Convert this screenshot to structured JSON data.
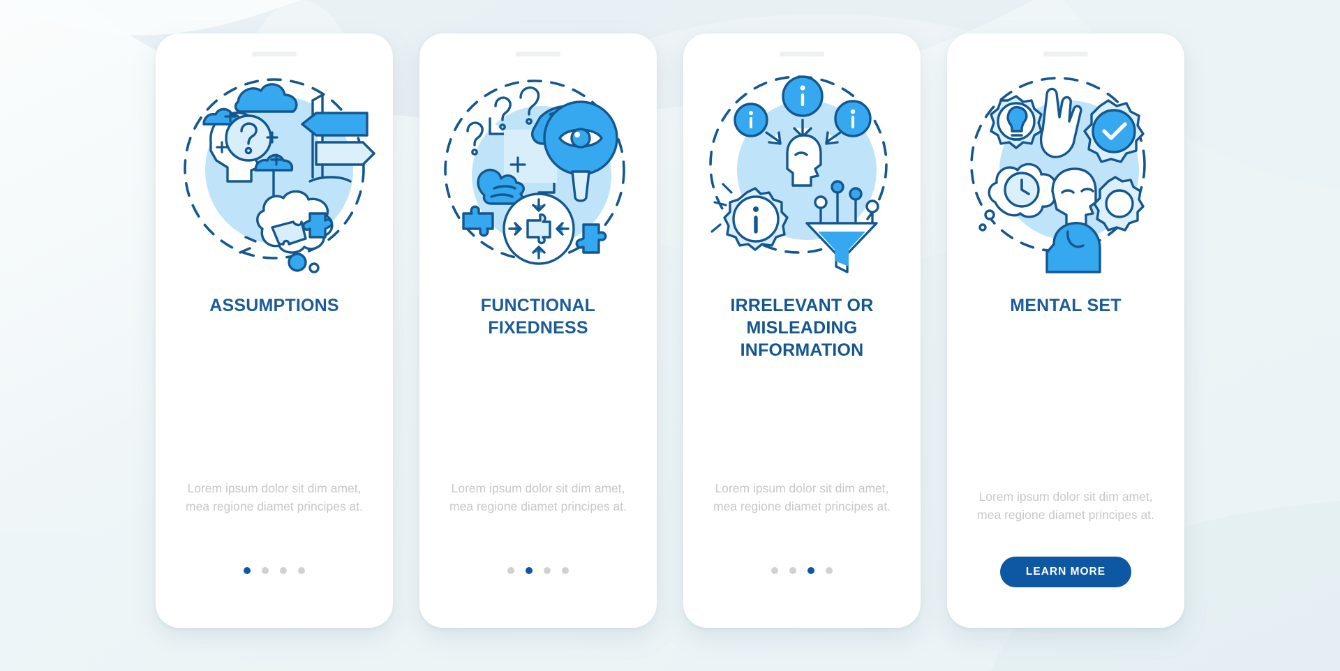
{
  "background": {
    "base_color": "#eef4f6",
    "accent_shape_color": "#e3edf1",
    "highlight_color": "#f7fbfc"
  },
  "palette": {
    "title_blue": "#1c5c96",
    "body_gray": "#c6c8c9",
    "dot_inactive": "#cfd2d4",
    "dot_active": "#0d57a3",
    "button_blue": "#0d57a3",
    "button_text": "#ffffff",
    "icon_stroke_dark": "#14578f",
    "icon_fill_mid": "#29a1ec",
    "icon_fill_light": "#b9e2f8",
    "icon_fill_pale": "#d8eefb",
    "notch_gray": "#eef0f1",
    "card_white": "#ffffff"
  },
  "shared": {
    "body_text": "Lorem ipsum dolor sit dim amet, mea regione diamet principes at.",
    "dot_count": 4
  },
  "screens": [
    {
      "id": "screen-assumptions",
      "title": "ASSUMPTIONS",
      "title_lines": [
        "ASSUMPTIONS"
      ],
      "body_text": "Lorem ipsum dolor sit dim amet, mea regione diamet principes at.",
      "active_dot_index": 0,
      "has_cta": false,
      "cta_label": "",
      "illustration": "assumptions-illustration",
      "illustration_icons": [
        "head-profile-icon",
        "question-mark-circle-icon",
        "cloud-icon",
        "signpost-icon",
        "thought-bubble-icon",
        "puzzle-piece-icon",
        "plus-sparkle-icon",
        "dashed-circle-icon"
      ]
    },
    {
      "id": "screen-functional-fixedness",
      "title": "FUNCTIONAL FIXEDNESS",
      "title_lines": [
        "FUNCTIONAL",
        "FIXEDNESS"
      ],
      "body_text": "Lorem ipsum dolor sit dim amet, mea regione diamet principes at.",
      "active_dot_index": 1,
      "has_cta": false,
      "cta_label": "",
      "illustration": "functional-fixedness-illustration",
      "illustration_icons": [
        "question-mark-icon",
        "hand-frame-icon",
        "magnifier-eye-icon",
        "puzzle-piece-icon",
        "circular-arrows-icon",
        "plus-sparkle-icon",
        "dashed-circle-icon"
      ]
    },
    {
      "id": "screen-irrelevant-misleading-information",
      "title": "IRRELEVANT OR MISLEADING INFORMATION",
      "title_lines": [
        "IRRELEVANT OR",
        "MISLEADING",
        "INFORMATION"
      ],
      "body_text": "Lorem ipsum dolor sit dim amet, mea regione diamet principes at.",
      "active_dot_index": 2,
      "has_cta": false,
      "cta_label": "",
      "illustration": "irrelevant-information-illustration",
      "illustration_icons": [
        "info-circle-icon",
        "head-profile-icon",
        "arrow-down-icon",
        "gear-info-icon",
        "funnel-icon",
        "data-nodes-icon",
        "dashed-circle-icon"
      ]
    },
    {
      "id": "screen-mental-set",
      "title": "MENTAL SET",
      "title_lines": [
        "MENTAL SET"
      ],
      "body_text": "Lorem ipsum dolor sit dim amet, mea regione diamet principes at.",
      "active_dot_index": 3,
      "has_cta": true,
      "cta_label": "LEARN MORE",
      "illustration": "mental-set-illustration",
      "illustration_icons": [
        "lightbulb-gear-icon",
        "hand-icon",
        "gear-check-icon",
        "gear-icon",
        "clock-cloud-icon",
        "person-thinking-icon",
        "dashed-circle-icon"
      ]
    }
  ]
}
